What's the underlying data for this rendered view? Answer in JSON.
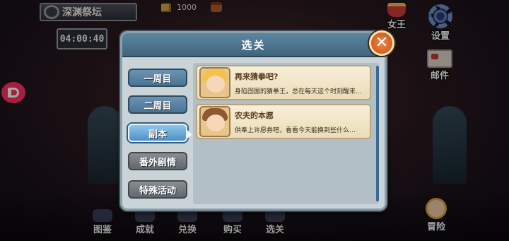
{
  "hud": {
    "area_name": "深渊祭坛",
    "timer": "04:00:40",
    "coins": "1000"
  },
  "side_menu": {
    "king_label": "女王",
    "settings_label": "设置",
    "mail_label": "邮件",
    "adventure_label": "冒险"
  },
  "bottom_nav": [
    {
      "label": "图鉴"
    },
    {
      "label": "成就"
    },
    {
      "label": "兑换"
    },
    {
      "label": "购买"
    },
    {
      "label": "选关"
    }
  ],
  "modal": {
    "title": "选关",
    "close_symbol": "✕",
    "tabs": [
      {
        "label": "一周目",
        "state": "normal"
      },
      {
        "label": "二周目",
        "state": "normal"
      },
      {
        "label": "副本",
        "state": "selected"
      },
      {
        "label": "番外剧情",
        "state": "disabled"
      },
      {
        "label": "特殊活动",
        "state": "disabled"
      }
    ],
    "items": [
      {
        "title": "再来猜拳吧?",
        "desc": "身陷囹圄的猜拳王，总在每天这个时刻醒来…",
        "portrait": "blonde-boy-portrait"
      },
      {
        "title": "农夫的本愿",
        "desc": "供奉上许愿券吧，看看今天能换到些什么…",
        "portrait": "brown-hair-boy-portrait"
      }
    ]
  },
  "colors": {
    "header_blue": "#4f7590",
    "tab_active": "#6fb0e0",
    "close_orange": "#e06a2a",
    "item_bg": "#f3e7c9"
  }
}
